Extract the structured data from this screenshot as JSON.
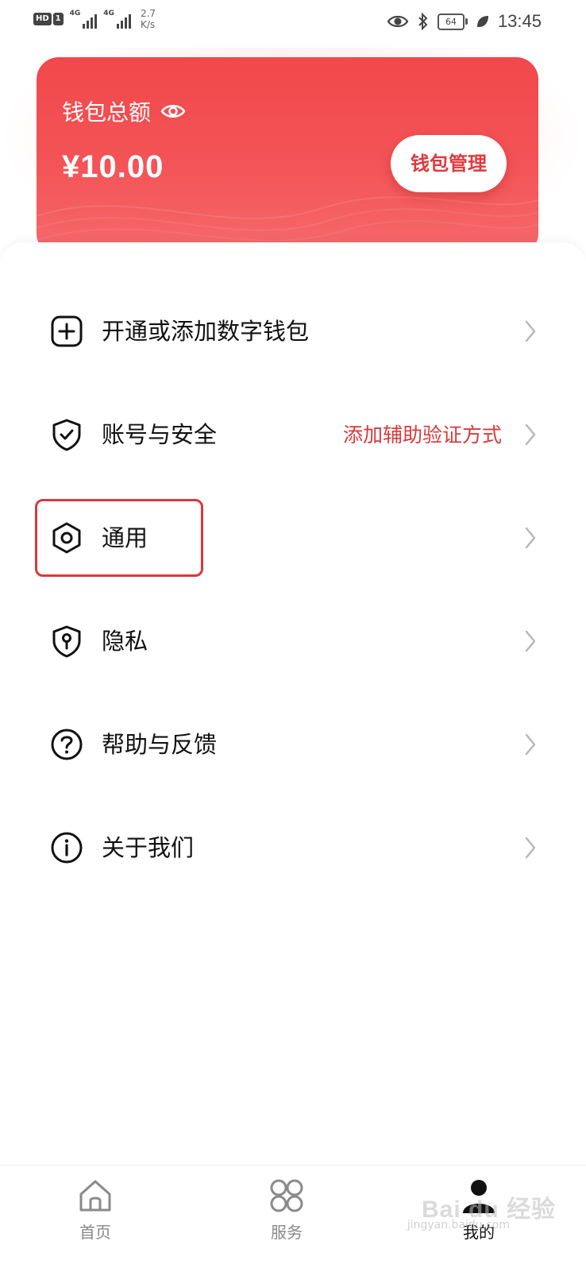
{
  "status_bar": {
    "hd_label": "HD",
    "sim_label": "1",
    "network_1": "4G",
    "network_2": "4G",
    "speed_value": "2.7",
    "speed_unit": "K/s",
    "battery": "64",
    "time": "13:45"
  },
  "wallet": {
    "title": "钱包总额",
    "amount": "¥10.00",
    "manage_button": "钱包管理"
  },
  "menu": {
    "items": [
      {
        "label": "开通或添加数字钱包",
        "hint": "",
        "icon": "plus-square-icon"
      },
      {
        "label": "账号与安全",
        "hint": "添加辅助验证方式",
        "icon": "shield-check-icon"
      },
      {
        "label": "通用",
        "hint": "",
        "icon": "hex-settings-icon"
      },
      {
        "label": "隐私",
        "hint": "",
        "icon": "privacy-shield-icon"
      },
      {
        "label": "帮助与反馈",
        "hint": "",
        "icon": "question-circle-icon"
      },
      {
        "label": "关于我们",
        "hint": "",
        "icon": "info-circle-icon"
      }
    ]
  },
  "bottom_nav": {
    "items": [
      {
        "label": "首页",
        "icon": "home-icon",
        "active": false
      },
      {
        "label": "服务",
        "icon": "grid-icon",
        "active": false
      },
      {
        "label": "我的",
        "icon": "person-icon",
        "active": true
      }
    ]
  },
  "watermark": {
    "text": "Bai du 经验",
    "sub": "jingyan.baidu.com"
  },
  "colors": {
    "accent_red": "#f2484b",
    "hint_red": "#d8393c",
    "text_dark": "#111111",
    "nav_inactive": "#888888"
  }
}
